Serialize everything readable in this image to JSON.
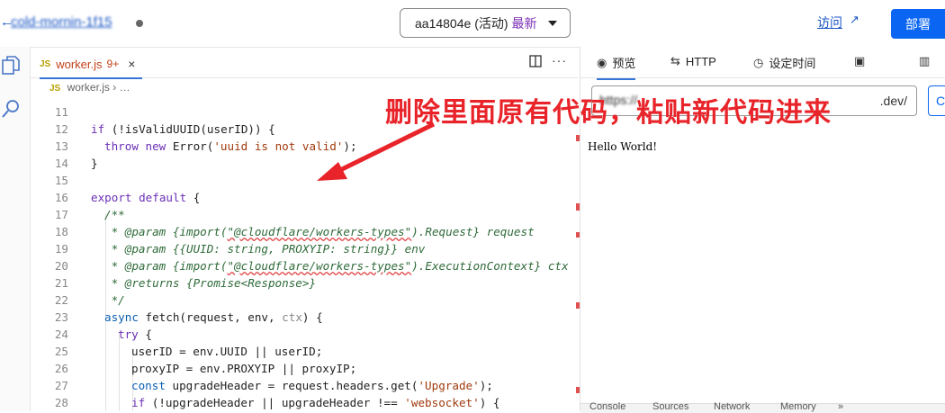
{
  "header": {
    "back_icon": "arrow-left-icon",
    "back_glyph": "←",
    "worker_name": "cold-mornin-1f15",
    "version_id": "aa14804e",
    "version_status": "(活动)",
    "version_latest": "最新",
    "visit_label": "访问",
    "deploy_label": "部署"
  },
  "editor": {
    "tab": {
      "lang": "JS",
      "filename": "worker.js",
      "problems": "9+",
      "close": "×"
    },
    "breadcrumb": {
      "lang": "JS",
      "file": "worker.js",
      "sep": "› …"
    },
    "lines": [
      {
        "n": "11"
      },
      {
        "n": "12"
      },
      {
        "n": "13"
      },
      {
        "n": "14"
      },
      {
        "n": "15"
      },
      {
        "n": "16"
      },
      {
        "n": "17"
      },
      {
        "n": "18"
      },
      {
        "n": "19"
      },
      {
        "n": "20"
      },
      {
        "n": "21"
      },
      {
        "n": "22"
      },
      {
        "n": "23"
      },
      {
        "n": "24"
      },
      {
        "n": "25"
      },
      {
        "n": "26"
      },
      {
        "n": "27"
      },
      {
        "n": "28"
      }
    ],
    "code": {
      "l12_a": "if",
      "l12_b": " (!isValidUUID(userID)) {",
      "l13_a": "throw new ",
      "l13_b": "Error(",
      "l13_c": "'uuid is not valid'",
      "l13_d": ");",
      "l14": "}",
      "l16_a": "export default",
      "l16_b": " {",
      "l17": "/**",
      "l18_a": " * @param {import(",
      "l18_b": "\"@cloudflare/workers-types\"",
      "l18_c": ").Request} request",
      "l19": " * @param {{UUID: string, PROXYIP: string}} env",
      "l20_a": " * @param {import(",
      "l20_b": "\"@cloudflare/workers-types\"",
      "l20_c": ").ExecutionContext} ctx",
      "l21": " * @returns {Promise<Response>}",
      "l22": " */",
      "l23_a": "async",
      "l23_b": " fetch(request, env, ",
      "l23_c": "ctx",
      "l23_d": ") {",
      "l24_a": "try",
      "l24_b": " {",
      "l25": "userID = env.UUID || userID;",
      "l26": "proxyIP = env.PROXYIP || proxyIP;",
      "l27_a": "const",
      "l27_b": " upgradeHeader = request.headers.get(",
      "l27_c": "'Upgrade'",
      "l27_d": ");",
      "l28_a": "if",
      "l28_b": " (!upgradeHeader || upgradeHeader !== ",
      "l28_c": "'websocket'",
      "l28_d": ") {"
    }
  },
  "preview": {
    "tabs": [
      {
        "label": "预览",
        "icon": "eye-icon"
      },
      {
        "label": "HTTP",
        "icon": "arrows-icon"
      },
      {
        "label": "设定时间",
        "icon": "clock-icon"
      },
      {
        "label": "",
        "icon": "terminal-icon"
      }
    ],
    "url_prefix": "https://",
    "url_suffix": ".dev/",
    "output": "Hello World!",
    "devtools_tabs": [
      "Console",
      "Sources",
      "Network",
      "Memory",
      "»"
    ]
  },
  "annotation": {
    "text": "删除里面原有代码，粘贴新代码进来",
    "color": "#e8242a"
  },
  "colors": {
    "accent": "#0a66f2",
    "link": "#1a56c4",
    "keyword": "#0b5fb3",
    "string": "#a03a0e",
    "comment": "#2f6b3a"
  }
}
